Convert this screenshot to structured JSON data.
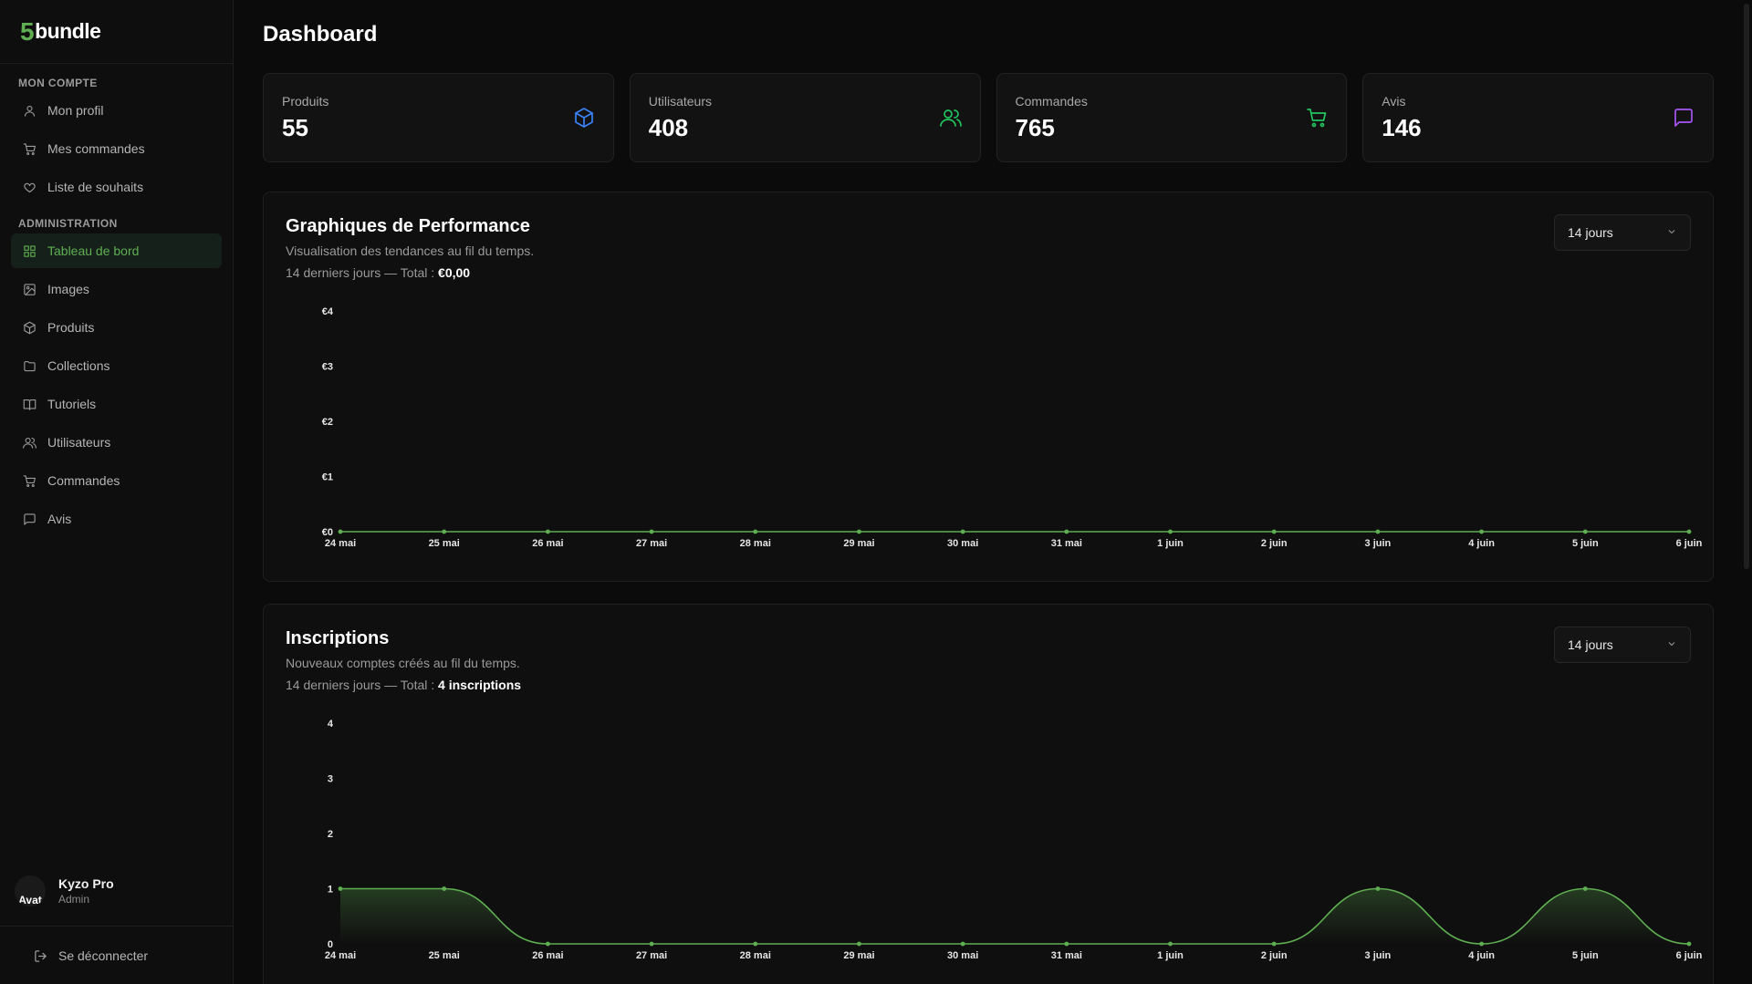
{
  "brand": {
    "five": "5",
    "word": "bundle"
  },
  "sidebar": {
    "account_title": "MON COMPTE",
    "account_items": [
      {
        "label": "Mon profil",
        "icon": "user-icon"
      },
      {
        "label": "Mes commandes",
        "icon": "cart-icon"
      },
      {
        "label": "Liste de souhaits",
        "icon": "heart-icon"
      }
    ],
    "admin_title": "ADMINISTRATION",
    "admin_items": [
      {
        "label": "Tableau de bord",
        "icon": "grid-icon",
        "active": true
      },
      {
        "label": "Images",
        "icon": "image-icon"
      },
      {
        "label": "Produits",
        "icon": "box-icon"
      },
      {
        "label": "Collections",
        "icon": "folder-icon"
      },
      {
        "label": "Tutoriels",
        "icon": "book-icon"
      },
      {
        "label": "Utilisateurs",
        "icon": "users-icon"
      },
      {
        "label": "Commandes",
        "icon": "cart-icon"
      },
      {
        "label": "Avis",
        "icon": "message-icon"
      }
    ],
    "user": {
      "name": "Kyzo Pro",
      "role": "Admin",
      "avatar_alt": "Avat"
    },
    "logout": "Se déconnecter"
  },
  "header": {
    "title": "Dashboard"
  },
  "stats": [
    {
      "label": "Produits",
      "value": "55",
      "icon": "box-icon",
      "color": "#3b82f6"
    },
    {
      "label": "Utilisateurs",
      "value": "408",
      "icon": "users-icon",
      "color": "#22c55e"
    },
    {
      "label": "Commandes",
      "value": "765",
      "icon": "cart-icon",
      "color": "#22c55e"
    },
    {
      "label": "Avis",
      "value": "146",
      "icon": "message-icon",
      "color": "#a855f7"
    }
  ],
  "accent_color": "#5fae52",
  "performance": {
    "title": "Graphiques de Performance",
    "subtitle": "Visualisation des tendances au fil du temps.",
    "total_prefix": "14 derniers jours — Total : ",
    "total_value": "€0,00",
    "range": "14 jours"
  },
  "signups": {
    "title": "Inscriptions",
    "subtitle": "Nouveaux comptes créés au fil du temps.",
    "total_prefix": "14 derniers jours — Total : ",
    "total_value": "4 inscriptions",
    "range": "14 jours"
  },
  "chart_data": [
    {
      "type": "line",
      "x": [
        "24 mai",
        "25 mai",
        "26 mai",
        "27 mai",
        "28 mai",
        "29 mai",
        "30 mai",
        "31 mai",
        "1 juin",
        "2 juin",
        "3 juin",
        "4 juin",
        "5 juin",
        "6 juin"
      ],
      "values": [
        0,
        0,
        0,
        0,
        0,
        0,
        0,
        0,
        0,
        0,
        0,
        0,
        0,
        0
      ],
      "yticks": [
        "€0",
        "€1",
        "€2",
        "€3",
        "€4"
      ],
      "ylim": [
        0,
        4
      ]
    },
    {
      "type": "area",
      "x": [
        "24 mai",
        "25 mai",
        "26 mai",
        "27 mai",
        "28 mai",
        "29 mai",
        "30 mai",
        "31 mai",
        "1 juin",
        "2 juin",
        "3 juin",
        "4 juin",
        "5 juin",
        "6 juin"
      ],
      "values": [
        1,
        1,
        0,
        0,
        0,
        0,
        0,
        0,
        0,
        0,
        1,
        0,
        1,
        0
      ],
      "yticks": [
        "0",
        "1",
        "2",
        "3",
        "4"
      ],
      "ylim": [
        0,
        4
      ]
    }
  ]
}
